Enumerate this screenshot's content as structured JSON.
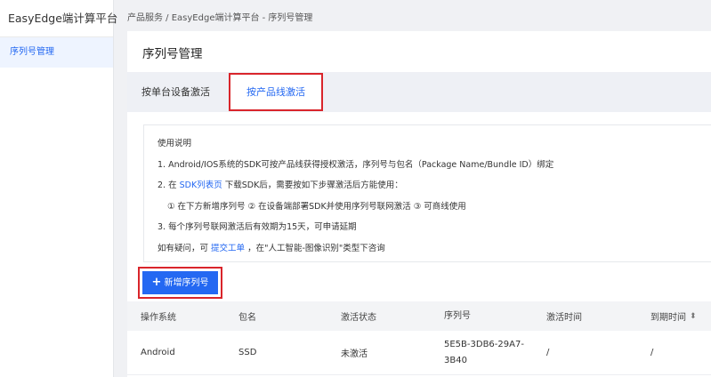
{
  "sidebar": {
    "brand": "EasyEdge端计算平台",
    "items": [
      {
        "label": "序列号管理"
      }
    ]
  },
  "breadcrumb": "产品服务 / EasyEdge端计算平台 - 序列号管理",
  "page_title": "序列号管理",
  "tabs": [
    {
      "label": "按单台设备激活",
      "active": false
    },
    {
      "label": "按产品线激活",
      "active": true
    }
  ],
  "notice": {
    "title": "使用说明",
    "line1": "1. Android/IOS系统的SDK可按产品线获得授权激活，序列号与包名（Package Name/Bundle ID）绑定",
    "line2_prefix": "2. 在",
    "line2_link": "SDK列表页",
    "line2_suffix": "下载SDK后，需要按如下步骤激活后方能使用：",
    "line3": "① 在下方新增序列号 ② 在设备端部署SDK并使用序列号联网激活 ③ 可商线使用",
    "line4": "3. 每个序列号联网激活后有效期为15天，可申请延期",
    "line5_prefix": "如有疑问，可",
    "line5_link": "提交工单",
    "line5_suffix": "，在\"人工智能-图像识别\"类型下咨询"
  },
  "add_button": {
    "label": "新增序列号"
  },
  "table": {
    "columns": [
      "操作系统",
      "包名",
      "激活状态",
      "序列号",
      "激活时间",
      "到期时间"
    ],
    "rows": [
      {
        "os": "Android",
        "package": "SSD",
        "status": "未激活",
        "serial": "5E5B-3DB6-29A7-3B40",
        "activated": "/",
        "expires": "/"
      }
    ]
  },
  "colors": {
    "accent": "#2468f2",
    "highlight_border": "#d9252b"
  },
  "icons": [
    "plus-icon",
    "sort-icon"
  ]
}
